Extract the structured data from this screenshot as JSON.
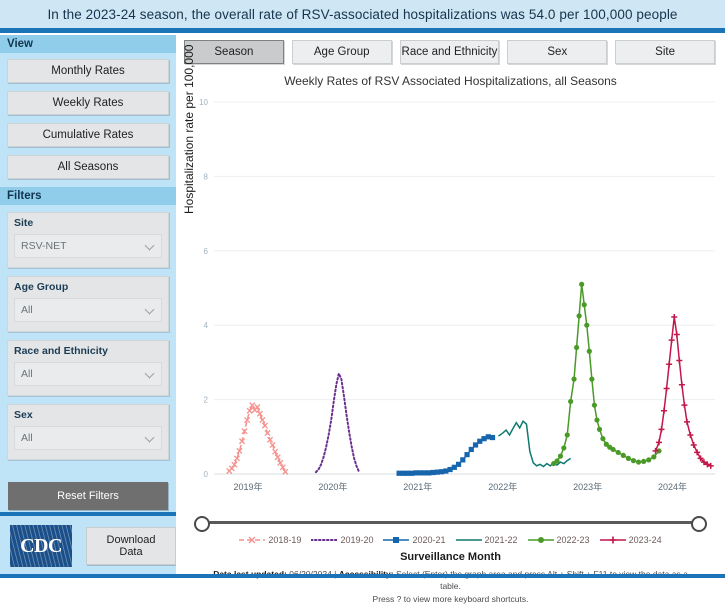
{
  "header": {
    "banner_text": "In the 2023-24 season, the overall rate of RSV-associated hospitalizations was 54.0 per 100,000 people",
    "banner_bg": "#cfe7f5",
    "rule_color": "#1b74b8"
  },
  "tabs": [
    {
      "label": "Season",
      "active": true
    },
    {
      "label": "Age Group",
      "active": false
    },
    {
      "label": "Race and Ethnicity",
      "active": false
    },
    {
      "label": "Sex",
      "active": false
    },
    {
      "label": "Site",
      "active": false
    }
  ],
  "sidebar": {
    "view_header": "View",
    "view_buttons": [
      {
        "label": "Monthly Rates"
      },
      {
        "label": "Weekly Rates"
      },
      {
        "label": "Cumulative Rates"
      },
      {
        "label": "All Seasons"
      }
    ],
    "filters_header": "Filters",
    "filters": [
      {
        "label": "Site",
        "value": "RSV-NET",
        "icon": "chevron-down-icon"
      },
      {
        "label": "Age Group",
        "value": "All",
        "icon": "chevron-down-icon"
      },
      {
        "label": "Race and Ethnicity",
        "value": "All",
        "icon": "chevron-down-icon"
      },
      {
        "label": "Sex",
        "value": "All",
        "icon": "chevron-down-icon"
      }
    ],
    "reset_label": "Reset Filters",
    "logo_text": "CDC",
    "download_label": "Download Data"
  },
  "footer": {
    "updated_label": "Data last updated:",
    "updated_value": "06/20/2024",
    "separator": "|",
    "accessibility_label": "Accessibility:",
    "accessibility_text": "Select (Enter) the graph area and press Alt + Shift + F11 to view the data as a table.",
    "shortcuts_text": "Press ? to view more keyboard shortcuts."
  },
  "chart_data": {
    "type": "line",
    "title": "Weekly Rates of RSV Associated Hospitalizations, all Seasons",
    "xlabel": "Surveillance Month",
    "ylabel": "Hospitalization rate per 100,000",
    "ylim": [
      0,
      10
    ],
    "yticks": [
      0,
      2,
      4,
      6,
      8,
      10
    ],
    "xticks": [
      "2019年",
      "2020年",
      "2021年",
      "2022年",
      "2023年",
      "2024年"
    ],
    "xlim": [
      2018.6,
      2024.5
    ],
    "grid": true,
    "legend_position": "bottom",
    "series": [
      {
        "name": "2018-19",
        "color": "#f4928f",
        "style": "dashed",
        "marker": "x",
        "x": [
          2018.78,
          2018.81,
          2018.84,
          2018.87,
          2018.9,
          2018.93,
          2018.96,
          2018.99,
          2019.02,
          2019.05,
          2019.08,
          2019.11,
          2019.14,
          2019.17,
          2019.2,
          2019.23,
          2019.26,
          2019.29,
          2019.32,
          2019.35,
          2019.38,
          2019.41,
          2019.44
        ],
        "y": [
          0.08,
          0.15,
          0.25,
          0.42,
          0.62,
          0.88,
          1.15,
          1.45,
          1.7,
          1.85,
          1.72,
          1.8,
          1.62,
          1.45,
          1.3,
          1.1,
          0.92,
          0.78,
          0.6,
          0.45,
          0.3,
          0.18,
          0.06
        ]
      },
      {
        "name": "2019-20",
        "color": "#6b2f8f",
        "style": "dotted",
        "marker": "none",
        "x": [
          2019.8,
          2019.83,
          2019.86,
          2019.89,
          2019.92,
          2019.95,
          2019.98,
          2020.01,
          2020.04,
          2020.07,
          2020.1,
          2020.13,
          2020.16,
          2020.19,
          2020.22,
          2020.25,
          2020.28,
          2020.31
        ],
        "y": [
          0.05,
          0.12,
          0.25,
          0.45,
          0.72,
          1.05,
          1.45,
          1.95,
          2.4,
          2.7,
          2.55,
          2.1,
          1.6,
          1.15,
          0.75,
          0.42,
          0.2,
          0.05
        ]
      },
      {
        "name": "2020-21",
        "color": "#1665ad",
        "style": "solid",
        "marker": "square",
        "x": [
          2020.78,
          2020.83,
          2020.88,
          2020.93,
          2020.98,
          2021.03,
          2021.08,
          2021.13,
          2021.18,
          2021.23,
          2021.28,
          2021.33,
          2021.38,
          2021.43,
          2021.48,
          2021.53,
          2021.58,
          2021.63,
          2021.68,
          2021.73,
          2021.78,
          2021.83,
          2021.88
        ],
        "y": [
          0.02,
          0.02,
          0.02,
          0.02,
          0.03,
          0.03,
          0.03,
          0.03,
          0.04,
          0.05,
          0.06,
          0.08,
          0.12,
          0.18,
          0.26,
          0.38,
          0.52,
          0.66,
          0.78,
          0.88,
          0.95,
          1.0,
          0.98
        ]
      },
      {
        "name": "2021-22",
        "color": "#0d7a6e",
        "style": "solid",
        "marker": "none",
        "x": [
          2021.95,
          2022.0,
          2022.04,
          2022.08,
          2022.12,
          2022.16,
          2022.2,
          2022.24,
          2022.28,
          2022.32,
          2022.36,
          2022.4,
          2022.44,
          2022.48,
          2022.52,
          2022.56,
          2022.6,
          2022.64,
          2022.68,
          2022.72,
          2022.76,
          2022.8
        ],
        "y": [
          1.02,
          1.1,
          1.18,
          1.05,
          1.22,
          1.38,
          1.24,
          1.42,
          1.34,
          0.6,
          0.3,
          0.22,
          0.26,
          0.2,
          0.28,
          0.22,
          0.3,
          0.24,
          0.32,
          0.28,
          0.36,
          0.42
        ]
      },
      {
        "name": "2022-23",
        "color": "#4a9a28",
        "style": "solid",
        "marker": "circle",
        "x": [
          2022.6,
          2022.64,
          2022.68,
          2022.72,
          2022.76,
          2022.8,
          2022.84,
          2022.87,
          2022.9,
          2022.93,
          2022.96,
          2022.99,
          2023.02,
          2023.05,
          2023.08,
          2023.11,
          2023.14,
          2023.18,
          2023.22,
          2023.26,
          2023.3,
          2023.36,
          2023.42,
          2023.48,
          2023.54,
          2023.6,
          2023.66,
          2023.72,
          2023.78,
          2023.84
        ],
        "y": [
          0.28,
          0.35,
          0.48,
          0.7,
          1.05,
          1.95,
          2.55,
          3.4,
          4.25,
          5.1,
          4.55,
          4.0,
          3.3,
          2.55,
          1.85,
          1.45,
          1.2,
          0.95,
          0.8,
          0.72,
          0.66,
          0.58,
          0.5,
          0.42,
          0.36,
          0.32,
          0.34,
          0.38,
          0.46,
          0.62
        ]
      },
      {
        "name": "2023-24",
        "color": "#c2174a",
        "style": "solid",
        "marker": "plus",
        "x": [
          2023.8,
          2023.84,
          2023.87,
          2023.9,
          2023.93,
          2023.96,
          2023.99,
          2024.02,
          2024.05,
          2024.08,
          2024.11,
          2024.14,
          2024.17,
          2024.21,
          2024.25,
          2024.29,
          2024.33,
          2024.37,
          2024.41,
          2024.45
        ],
        "y": [
          0.62,
          0.85,
          1.2,
          1.7,
          2.3,
          2.95,
          3.6,
          4.22,
          3.75,
          3.05,
          2.4,
          1.85,
          1.4,
          1.05,
          0.78,
          0.58,
          0.42,
          0.32,
          0.26,
          0.22
        ]
      }
    ]
  }
}
